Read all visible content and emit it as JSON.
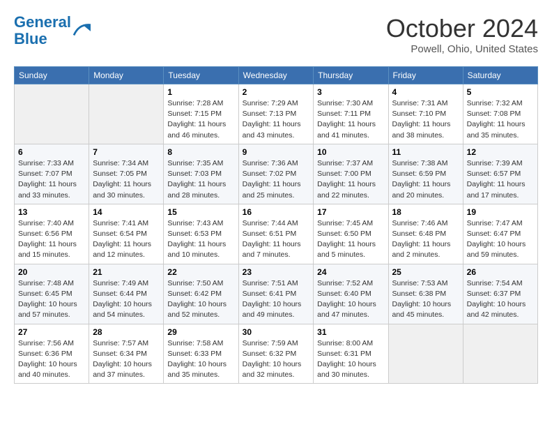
{
  "header": {
    "logo_line1": "General",
    "logo_line2": "Blue",
    "title": "October 2024",
    "location": "Powell, Ohio, United States"
  },
  "days_of_week": [
    "Sunday",
    "Monday",
    "Tuesday",
    "Wednesday",
    "Thursday",
    "Friday",
    "Saturday"
  ],
  "weeks": [
    [
      {
        "day": "",
        "info": ""
      },
      {
        "day": "",
        "info": ""
      },
      {
        "day": "1",
        "info": "Sunrise: 7:28 AM\nSunset: 7:15 PM\nDaylight: 11 hours and 46 minutes."
      },
      {
        "day": "2",
        "info": "Sunrise: 7:29 AM\nSunset: 7:13 PM\nDaylight: 11 hours and 43 minutes."
      },
      {
        "day": "3",
        "info": "Sunrise: 7:30 AM\nSunset: 7:11 PM\nDaylight: 11 hours and 41 minutes."
      },
      {
        "day": "4",
        "info": "Sunrise: 7:31 AM\nSunset: 7:10 PM\nDaylight: 11 hours and 38 minutes."
      },
      {
        "day": "5",
        "info": "Sunrise: 7:32 AM\nSunset: 7:08 PM\nDaylight: 11 hours and 35 minutes."
      }
    ],
    [
      {
        "day": "6",
        "info": "Sunrise: 7:33 AM\nSunset: 7:07 PM\nDaylight: 11 hours and 33 minutes."
      },
      {
        "day": "7",
        "info": "Sunrise: 7:34 AM\nSunset: 7:05 PM\nDaylight: 11 hours and 30 minutes."
      },
      {
        "day": "8",
        "info": "Sunrise: 7:35 AM\nSunset: 7:03 PM\nDaylight: 11 hours and 28 minutes."
      },
      {
        "day": "9",
        "info": "Sunrise: 7:36 AM\nSunset: 7:02 PM\nDaylight: 11 hours and 25 minutes."
      },
      {
        "day": "10",
        "info": "Sunrise: 7:37 AM\nSunset: 7:00 PM\nDaylight: 11 hours and 22 minutes."
      },
      {
        "day": "11",
        "info": "Sunrise: 7:38 AM\nSunset: 6:59 PM\nDaylight: 11 hours and 20 minutes."
      },
      {
        "day": "12",
        "info": "Sunrise: 7:39 AM\nSunset: 6:57 PM\nDaylight: 11 hours and 17 minutes."
      }
    ],
    [
      {
        "day": "13",
        "info": "Sunrise: 7:40 AM\nSunset: 6:56 PM\nDaylight: 11 hours and 15 minutes."
      },
      {
        "day": "14",
        "info": "Sunrise: 7:41 AM\nSunset: 6:54 PM\nDaylight: 11 hours and 12 minutes."
      },
      {
        "day": "15",
        "info": "Sunrise: 7:43 AM\nSunset: 6:53 PM\nDaylight: 11 hours and 10 minutes."
      },
      {
        "day": "16",
        "info": "Sunrise: 7:44 AM\nSunset: 6:51 PM\nDaylight: 11 hours and 7 minutes."
      },
      {
        "day": "17",
        "info": "Sunrise: 7:45 AM\nSunset: 6:50 PM\nDaylight: 11 hours and 5 minutes."
      },
      {
        "day": "18",
        "info": "Sunrise: 7:46 AM\nSunset: 6:48 PM\nDaylight: 11 hours and 2 minutes."
      },
      {
        "day": "19",
        "info": "Sunrise: 7:47 AM\nSunset: 6:47 PM\nDaylight: 10 hours and 59 minutes."
      }
    ],
    [
      {
        "day": "20",
        "info": "Sunrise: 7:48 AM\nSunset: 6:45 PM\nDaylight: 10 hours and 57 minutes."
      },
      {
        "day": "21",
        "info": "Sunrise: 7:49 AM\nSunset: 6:44 PM\nDaylight: 10 hours and 54 minutes."
      },
      {
        "day": "22",
        "info": "Sunrise: 7:50 AM\nSunset: 6:42 PM\nDaylight: 10 hours and 52 minutes."
      },
      {
        "day": "23",
        "info": "Sunrise: 7:51 AM\nSunset: 6:41 PM\nDaylight: 10 hours and 49 minutes."
      },
      {
        "day": "24",
        "info": "Sunrise: 7:52 AM\nSunset: 6:40 PM\nDaylight: 10 hours and 47 minutes."
      },
      {
        "day": "25",
        "info": "Sunrise: 7:53 AM\nSunset: 6:38 PM\nDaylight: 10 hours and 45 minutes."
      },
      {
        "day": "26",
        "info": "Sunrise: 7:54 AM\nSunset: 6:37 PM\nDaylight: 10 hours and 42 minutes."
      }
    ],
    [
      {
        "day": "27",
        "info": "Sunrise: 7:56 AM\nSunset: 6:36 PM\nDaylight: 10 hours and 40 minutes."
      },
      {
        "day": "28",
        "info": "Sunrise: 7:57 AM\nSunset: 6:34 PM\nDaylight: 10 hours and 37 minutes."
      },
      {
        "day": "29",
        "info": "Sunrise: 7:58 AM\nSunset: 6:33 PM\nDaylight: 10 hours and 35 minutes."
      },
      {
        "day": "30",
        "info": "Sunrise: 7:59 AM\nSunset: 6:32 PM\nDaylight: 10 hours and 32 minutes."
      },
      {
        "day": "31",
        "info": "Sunrise: 8:00 AM\nSunset: 6:31 PM\nDaylight: 10 hours and 30 minutes."
      },
      {
        "day": "",
        "info": ""
      },
      {
        "day": "",
        "info": ""
      }
    ]
  ]
}
